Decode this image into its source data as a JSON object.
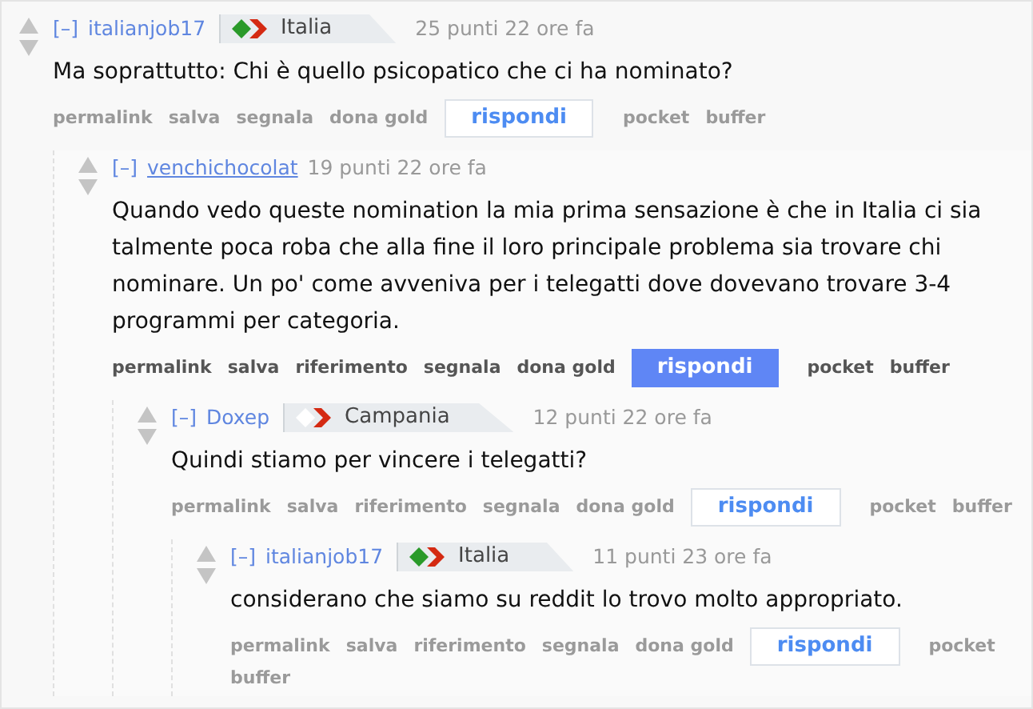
{
  "comments": [
    {
      "collapse": "[–]",
      "author": "italianjob17",
      "flair": {
        "kind": "italia",
        "label": "Italia"
      },
      "meta": "25 punti 22 ore fa",
      "body": "Ma soprattutto: Chi è quello psicopatico che ci ha nominato?",
      "highlighted": false,
      "actions": [
        "permalink",
        "salva",
        "segnala",
        "dona gold"
      ],
      "reply": "rispondi",
      "extras": [
        "pocket",
        "buffer"
      ],
      "children": [
        {
          "collapse": "[–]",
          "author": "venchichocolat",
          "meta": "19 punti 22 ore fa",
          "body": "Quando vedo queste nomination la mia prima sensazione è che in Italia ci sia talmente poca roba che alla fine il loro principale problema sia trovare chi nominare. Un po' come avveniva per i telegatti dove dovevano trovare 3-4 programmi per categoria.",
          "highlighted": true,
          "actions": [
            "permalink",
            "salva",
            "riferimento",
            "segnala",
            "dona gold"
          ],
          "reply": "rispondi",
          "extras": [
            "pocket",
            "buffer"
          ],
          "children": [
            {
              "collapse": "[–]",
              "author": "Doxep",
              "flair": {
                "kind": "campania",
                "label": "Campania"
              },
              "meta": "12 punti 22 ore fa",
              "body": "Quindi stiamo per vincere i telegatti?",
              "highlighted": false,
              "actions": [
                "permalink",
                "salva",
                "riferimento",
                "segnala",
                "dona gold"
              ],
              "reply": "rispondi",
              "extras": [
                "pocket",
                "buffer"
              ],
              "children": [
                {
                  "collapse": "[–]",
                  "author": "italianjob17",
                  "flair": {
                    "kind": "italia",
                    "label": "Italia"
                  },
                  "meta": "11 punti 23 ore fa",
                  "body": "considerano che siamo su reddit lo trovo molto appropriato.",
                  "highlighted": false,
                  "actions": [
                    "permalink",
                    "salva",
                    "riferimento",
                    "segnala",
                    "dona gold"
                  ],
                  "reply": "rispondi",
                  "extras": [
                    "pocket",
                    "buffer"
                  ]
                }
              ]
            }
          ]
        }
      ]
    }
  ]
}
